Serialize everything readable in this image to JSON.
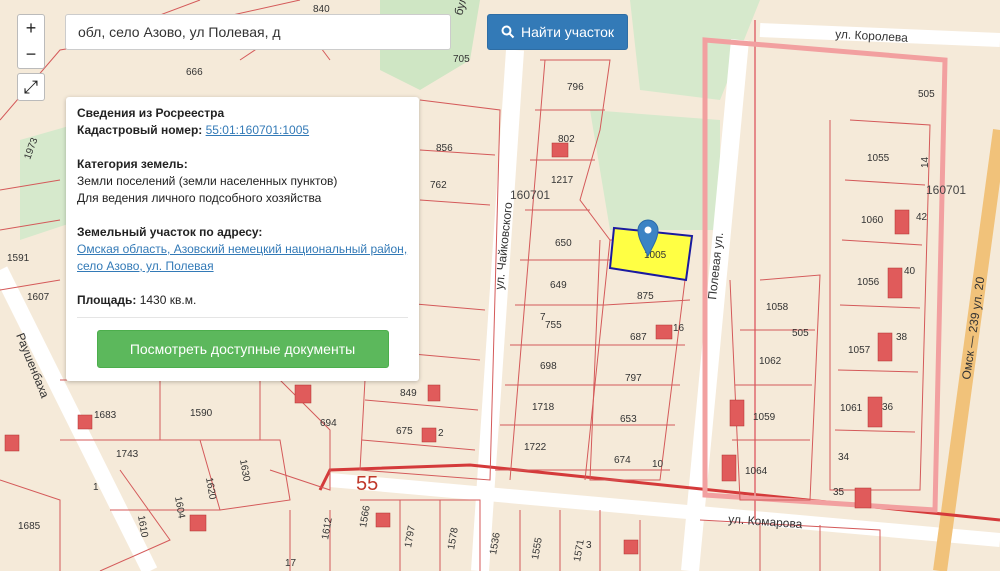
{
  "search": {
    "value": "обл, село Азово, ул Полевая, д",
    "button_label": "Найти участок"
  },
  "controls": {
    "zoom_in": "+",
    "zoom_out": "−",
    "fullscreen": "⤢"
  },
  "info": {
    "title": "Сведения из Росреестра",
    "cadastral_label": "Кадастровый номер:",
    "cadastral_number": "55:01:160701:1005",
    "category_label": "Категория земель:",
    "category_value": "Земли поселений (земли населенных пунктов)",
    "usage_value": "Для ведения личного подсобного хозяйства",
    "address_label": "Земельный участок по адресу:",
    "address_value": "Омская область, Азовский немецкий национальный район, село Азово, ул. Полевая",
    "area_label": "Площадь:",
    "area_value": "1430 кв.м.",
    "docs_button": "Посмотреть доступные документы"
  },
  "map": {
    "streets": {
      "korolyova": "ул. Королева",
      "chaikovskogo": "ул. Чайковского",
      "polevaya": "Полевая ул.",
      "komarova": "ул. Комарова",
      "raushenbakha": "Раушенбаха",
      "bul": "бул",
      "omsk_road": "Омск — 239 ул. 20"
    },
    "zones": {
      "z1": "160701",
      "z2": "160701",
      "quarter": "55"
    },
    "parcels": [
      "840",
      "666",
      "705",
      "796",
      "802",
      "1217",
      "856",
      "762",
      "650",
      "649",
      "755",
      "698",
      "1718",
      "1722",
      "875",
      "687",
      "797",
      "653",
      "674",
      "1005",
      "1058",
      "1062",
      "1059",
      "1064",
      "505",
      "1055",
      "1060",
      "1056",
      "1057",
      "1061",
      "34",
      "35",
      "1973",
      "1591",
      "1607",
      "1683",
      "1590",
      "1743",
      "1630",
      "1620",
      "1604",
      "1610",
      "1685",
      "694",
      "849",
      "675",
      "1566",
      "1797",
      "1578",
      "1536",
      "1555",
      "1571",
      "1612",
      "14",
      "42",
      "40",
      "38",
      "36",
      "16",
      "10",
      "7",
      "1",
      "3",
      "17",
      "2",
      "505"
    ],
    "selected_parcel": "1005",
    "colors": {
      "background": "#f5ead9",
      "parcel_border": "#d45a5a",
      "selected_fill": "#ffff44",
      "selected_border": "#1a1aa0",
      "green_area": "#cfe6c4",
      "marker": "#3b83c4",
      "building": "#e05b5b"
    }
  }
}
